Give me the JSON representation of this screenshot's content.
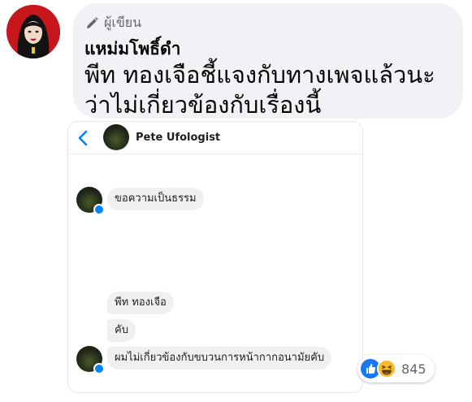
{
  "comment": {
    "badge_label": "ผู้เขียน",
    "author": "แหม่มโพธิ์ดำ",
    "text": "พีท ทองเจือชี้แจงกับทางเพจแล้วนะ ว่าไม่เกี่ยวข้องกับเรื่องนี้"
  },
  "messenger": {
    "page_name": "Pete Ufologist",
    "messages": [
      "ขอความเป็นธรรม",
      "พีท ทองเจือ",
      "คับ",
      "ผมไม่เกี่ยวข้องกับขบวนการหน้ากากอนามัยคับ"
    ]
  },
  "reactions": {
    "count": "845",
    "icons": [
      "like-icon",
      "haha-icon"
    ]
  },
  "colors": {
    "bubble_bg": "#f0f2f5",
    "messenger_blue": "#0084ff",
    "like_blue": "#1877f2",
    "haha_yellow": "#f7b928"
  }
}
